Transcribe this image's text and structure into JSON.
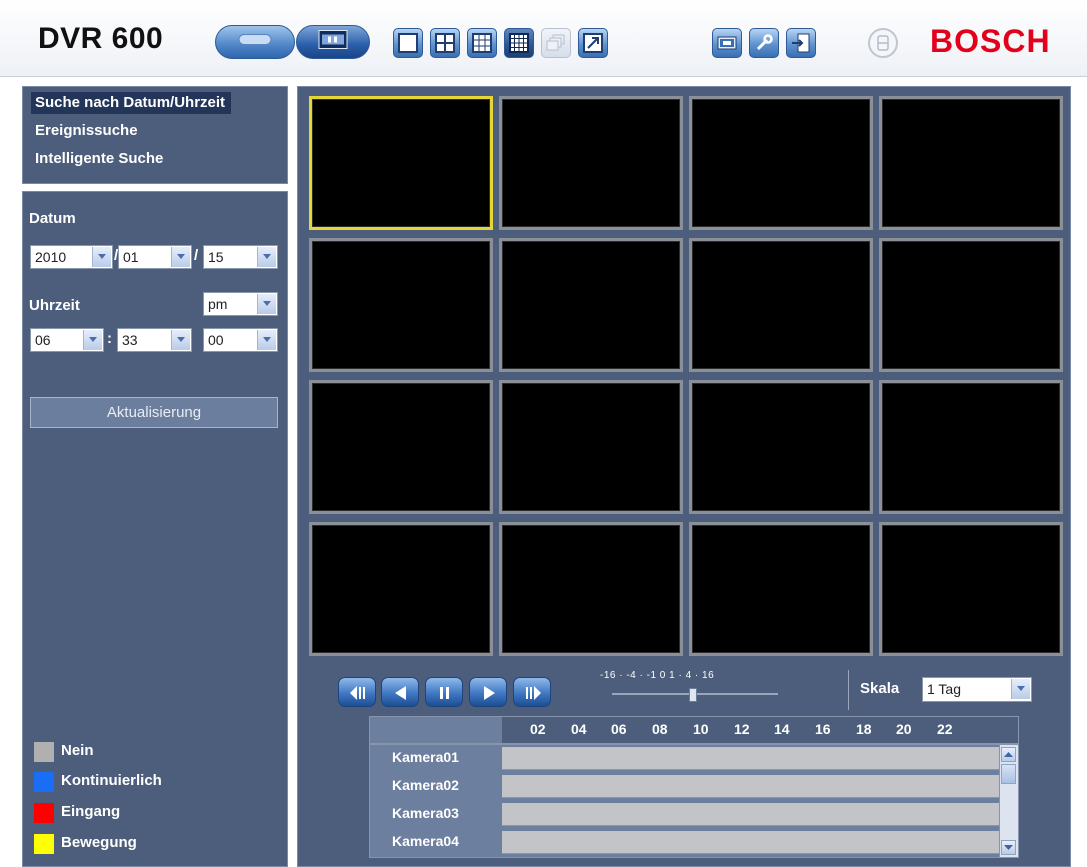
{
  "app": {
    "title": "DVR 600",
    "brand": "BOSCH",
    "brand_color": "#e3001b"
  },
  "toolbar": {
    "modes": [
      {
        "name": "live-view",
        "icon": "camera-icon"
      },
      {
        "name": "playback",
        "icon": "film-icon",
        "active": true
      }
    ],
    "layout_buttons": [
      {
        "icon": "layout-1-icon"
      },
      {
        "icon": "layout-4-icon"
      },
      {
        "icon": "layout-9-icon"
      },
      {
        "icon": "layout-16-icon",
        "active": true
      },
      {
        "icon": "sequence-icon",
        "disabled": true
      },
      {
        "icon": "fullscreen-icon"
      }
    ],
    "tool_buttons": [
      {
        "icon": "export-icon"
      },
      {
        "icon": "wrench-icon"
      },
      {
        "icon": "logout-icon"
      },
      {
        "icon": "print-icon"
      }
    ]
  },
  "search": {
    "items": [
      {
        "label": "Suche nach Datum/Uhrzeit",
        "active": true
      },
      {
        "label": "Ereignissuche"
      },
      {
        "label": "Intelligente Suche"
      }
    ]
  },
  "date": {
    "label": "Datum",
    "year": "2010",
    "month": "01",
    "day": "15",
    "separator": "/"
  },
  "time": {
    "label": "Uhrzeit",
    "ampm": "pm",
    "hour": "06",
    "minute": "33",
    "second": "00",
    "separator": ":"
  },
  "update_button": "Aktualisierung",
  "legend": [
    {
      "label": "Nein",
      "color": "#b0b0b0"
    },
    {
      "label": "Kontinuierlich",
      "color": "#1a6df5"
    },
    {
      "label": "Eingang",
      "color": "#ff0000"
    },
    {
      "label": "Bewegung",
      "color": "#ffff00"
    }
  ],
  "video_grid": {
    "rows": 4,
    "cols": 4,
    "selected_index": 0
  },
  "playback": {
    "speed_ticks": "-16 ·  -4 ·  -1  0  1 ·  4 ·  16",
    "speed_value": 0
  },
  "scale": {
    "label": "Skala",
    "value": "1 Tag"
  },
  "timeline": {
    "hours": [
      "02",
      "04",
      "06",
      "08",
      "10",
      "12",
      "14",
      "16",
      "18",
      "20",
      "22"
    ],
    "cameras": [
      "Kamera01",
      "Kamera02",
      "Kamera03",
      "Kamera04"
    ]
  }
}
